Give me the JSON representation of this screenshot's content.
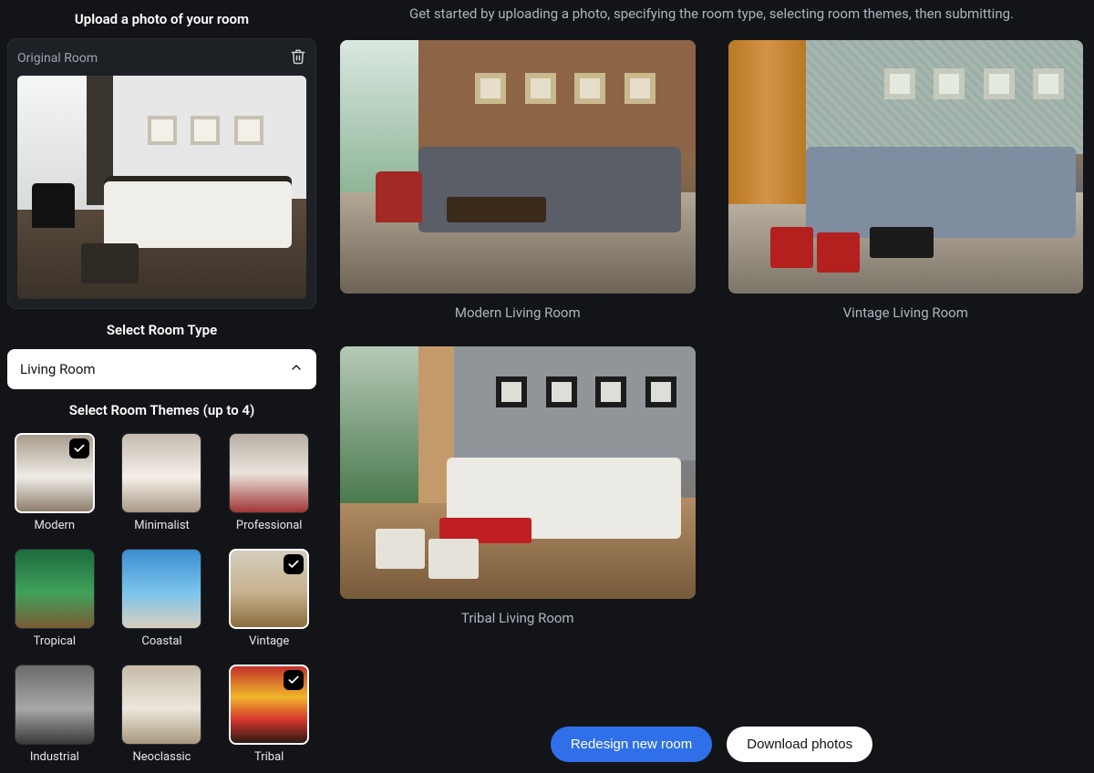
{
  "sidebar": {
    "upload_title": "Upload a photo of your room",
    "original_room_label": "Original Room",
    "room_type_title": "Select Room Type",
    "room_type_value": "Living Room",
    "themes_title": "Select Room Themes (up to 4)",
    "themes": [
      {
        "key": "modern",
        "label": "Modern",
        "selected": true,
        "class": "tg-modern"
      },
      {
        "key": "minimalist",
        "label": "Minimalist",
        "selected": false,
        "class": "tg-minimalist"
      },
      {
        "key": "professional",
        "label": "Professional",
        "selected": false,
        "class": "tg-professional"
      },
      {
        "key": "tropical",
        "label": "Tropical",
        "selected": false,
        "class": "tg-tropical"
      },
      {
        "key": "coastal",
        "label": "Coastal",
        "selected": false,
        "class": "tg-coastal"
      },
      {
        "key": "vintage",
        "label": "Vintage",
        "selected": true,
        "class": "tg-vintage"
      },
      {
        "key": "industrial",
        "label": "Industrial",
        "selected": false,
        "class": "tg-industrial"
      },
      {
        "key": "neoclassic",
        "label": "Neoclassic",
        "selected": false,
        "class": "tg-neoclassic"
      },
      {
        "key": "tribal",
        "label": "Tribal",
        "selected": true,
        "class": "tg-tribal"
      }
    ]
  },
  "main": {
    "instructions": "Get started by uploading a photo, specifying the room type, selecting room themes, then submitting.",
    "results": [
      {
        "key": "modern",
        "caption": "Modern Living Room",
        "class": "rt-modern"
      },
      {
        "key": "vintage",
        "caption": "Vintage Living Room",
        "class": "rt-vintage"
      },
      {
        "key": "tribal",
        "caption": "Tribal Living Room",
        "class": "rt-tribal"
      }
    ],
    "actions": {
      "redesign_label": "Redesign new room",
      "download_label": "Download photos"
    }
  },
  "colors": {
    "primary": "#2f6fe8",
    "bg": "#121418",
    "panel": "#1d2024",
    "text_muted": "#aeb4bd"
  }
}
